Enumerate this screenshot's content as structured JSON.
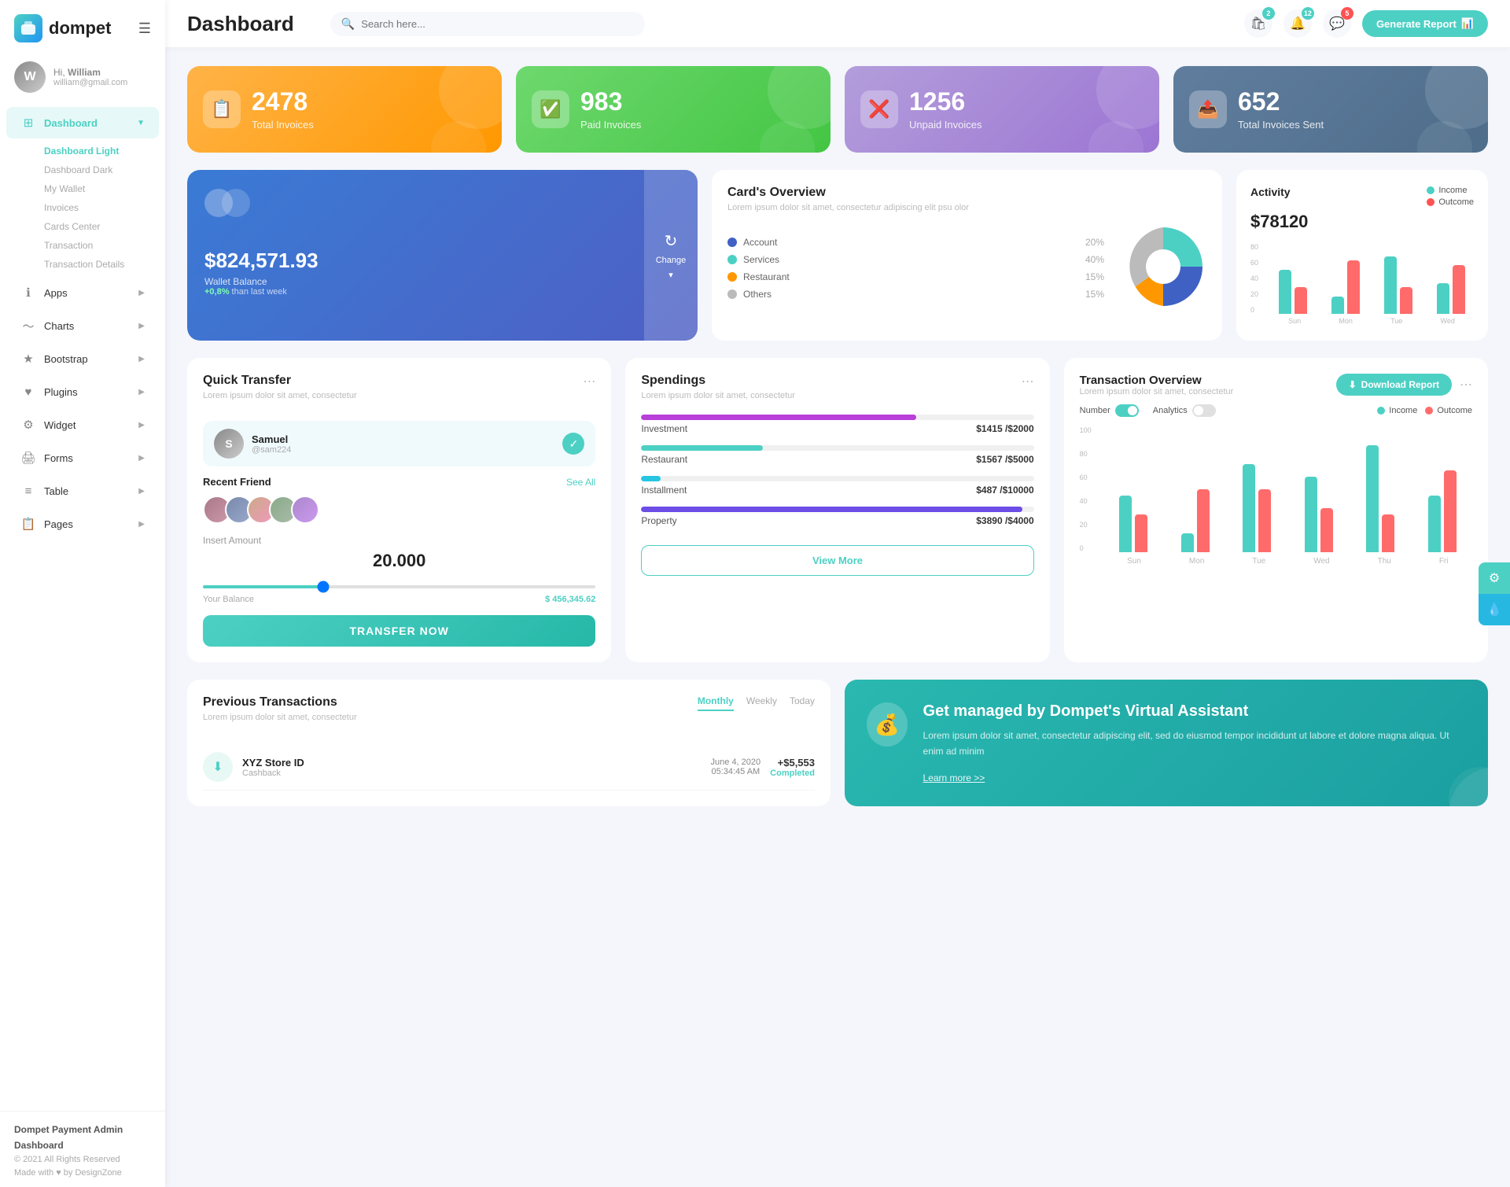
{
  "brand": {
    "logo_text": "dompet",
    "logo_icon": "💳"
  },
  "user": {
    "greeting": "Hi,",
    "name": "William",
    "email": "william@gmail.com",
    "avatar_initial": "W"
  },
  "sidebar": {
    "menu_icon": "☰",
    "nav_items": [
      {
        "id": "dashboard",
        "label": "Dashboard",
        "icon": "⊞",
        "active": true,
        "has_children": true
      },
      {
        "id": "apps",
        "label": "Apps",
        "icon": "ℹ",
        "active": false,
        "has_children": true
      },
      {
        "id": "charts",
        "label": "Charts",
        "icon": "📈",
        "active": false,
        "has_children": true
      },
      {
        "id": "bootstrap",
        "label": "Bootstrap",
        "icon": "★",
        "active": false,
        "has_children": true
      },
      {
        "id": "plugins",
        "label": "Plugins",
        "icon": "♥",
        "active": false,
        "has_children": true
      },
      {
        "id": "widget",
        "label": "Widget",
        "icon": "⚙",
        "active": false,
        "has_children": true
      },
      {
        "id": "forms",
        "label": "Forms",
        "icon": "🖨",
        "active": false,
        "has_children": true
      },
      {
        "id": "table",
        "label": "Table",
        "icon": "≡",
        "active": false,
        "has_children": true
      },
      {
        "id": "pages",
        "label": "Pages",
        "icon": "📋",
        "active": false,
        "has_children": true
      }
    ],
    "sub_items": [
      {
        "label": "Dashboard Light",
        "active": true
      },
      {
        "label": "Dashboard Dark",
        "active": false
      },
      {
        "label": "My Wallet",
        "active": false
      },
      {
        "label": "Invoices",
        "active": false
      },
      {
        "label": "Cards Center",
        "active": false
      },
      {
        "label": "Transaction",
        "active": false
      },
      {
        "label": "Transaction Details",
        "active": false
      }
    ],
    "footer": {
      "title": "Dompet Payment Admin Dashboard",
      "year": "© 2021 All Rights Reserved",
      "made_with": "Made with ♥ by DesignZone"
    }
  },
  "topbar": {
    "title": "Dashboard",
    "search_placeholder": "Search here...",
    "notifications": [
      {
        "icon": "🛍",
        "count": 2,
        "color": "teal"
      },
      {
        "icon": "🔔",
        "count": 12,
        "color": "teal"
      },
      {
        "icon": "💬",
        "count": 5,
        "color": "red"
      }
    ],
    "generate_btn": "Generate Report"
  },
  "stat_cards": [
    {
      "id": "total-invoices",
      "number": "2478",
      "label": "Total Invoices",
      "color": "orange",
      "icon": "📋"
    },
    {
      "id": "paid-invoices",
      "number": "983",
      "label": "Paid Invoices",
      "color": "green",
      "icon": "✅"
    },
    {
      "id": "unpaid-invoices",
      "number": "1256",
      "label": "Unpaid Invoices",
      "color": "purple",
      "icon": "❌"
    },
    {
      "id": "total-sent",
      "number": "652",
      "label": "Total Invoices Sent",
      "color": "blue-gray",
      "icon": "📤"
    }
  ],
  "wallet": {
    "balance": "$824,571.93",
    "label": "Wallet Balance",
    "change_text": "+0,8% than last week",
    "change_btn": "Change"
  },
  "cards_overview": {
    "title": "Card's Overview",
    "subtitle": "Lorem ipsum dolor sit amet, consectetur adipiscing elit psu olor",
    "items": [
      {
        "label": "Account",
        "percent": "20%",
        "color": "#3f61c4"
      },
      {
        "label": "Services",
        "percent": "40%",
        "color": "#4dd0c4"
      },
      {
        "label": "Restaurant",
        "percent": "15%",
        "color": "#ff9800"
      },
      {
        "label": "Others",
        "percent": "15%",
        "color": "#bbb"
      }
    ],
    "pie_data": [
      {
        "label": "Account",
        "value": 20,
        "color": "#3f61c4"
      },
      {
        "label": "Services",
        "value": 40,
        "color": "#4dd0c4"
      },
      {
        "label": "Restaurant",
        "value": 15,
        "color": "#ff9800"
      },
      {
        "label": "Others",
        "value": 25,
        "color": "#bbb"
      }
    ]
  },
  "activity": {
    "title": "Activity",
    "amount": "$78120",
    "legend": [
      {
        "label": "Income",
        "color": "#4dd0c4"
      },
      {
        "label": "Outcome",
        "color": "#ff5252"
      }
    ],
    "chart": {
      "labels": [
        "Sun",
        "Mon",
        "Tue",
        "Wed"
      ],
      "income": [
        50,
        20,
        65,
        35
      ],
      "outcome": [
        30,
        60,
        30,
        55
      ]
    }
  },
  "quick_transfer": {
    "title": "Quick Transfer",
    "subtitle": "Lorem ipsum dolor sit amet, consectetur",
    "person": {
      "name": "Samuel",
      "handle": "@sam224",
      "avatar_initial": "S"
    },
    "recent_label": "Recent Friend",
    "see_more": "See All",
    "amount_label": "Insert Amount",
    "amount_value": "20.000",
    "balance_label": "Your Balance",
    "balance_value": "$ 456,345.62",
    "btn_label": "TRANSFER NOW"
  },
  "spendings": {
    "title": "Spendings",
    "subtitle": "Lorem ipsum dolor sit amet, consectetur",
    "items": [
      {
        "name": "Investment",
        "spent": "$1415",
        "max": "$2000",
        "percent": 70,
        "color": "#b83fd8"
      },
      {
        "name": "Restaurant",
        "spent": "$1567",
        "max": "$5000",
        "percent": 31,
        "color": "#4dd0c4"
      },
      {
        "name": "Installment",
        "spent": "$487",
        "max": "$10000",
        "percent": 5,
        "color": "#26c6e0"
      },
      {
        "name": "Property",
        "spent": "$3890",
        "max": "$4000",
        "percent": 97,
        "color": "#6c4de6"
      }
    ],
    "view_more": "View More"
  },
  "transaction_overview": {
    "title": "Transaction Overview",
    "subtitle": "Lorem ipsum dolor sit amet, consectetur",
    "download_btn": "Download Report",
    "toggle_number": "Number",
    "toggle_analytics": "Analytics",
    "legend": [
      {
        "label": "Income",
        "color": "#4dd0c4"
      },
      {
        "label": "Outcome",
        "color": "#ff6b6b"
      }
    ],
    "chart": {
      "y_labels": [
        "100",
        "80",
        "60",
        "40",
        "20",
        "0"
      ],
      "x_labels": [
        "Sun",
        "Mon",
        "Tue",
        "Wed",
        "Thu",
        "Fri"
      ],
      "income": [
        45,
        25,
        70,
        60,
        85,
        50
      ],
      "outcome": [
        30,
        55,
        50,
        35,
        30,
        65
      ]
    }
  },
  "prev_transactions": {
    "title": "Previous Transactions",
    "subtitle": "Lorem ipsum dolor sit amet, consectetur",
    "tabs": [
      "Monthly",
      "Weekly",
      "Today"
    ],
    "active_tab": "Monthly",
    "items": [
      {
        "icon": "⬇",
        "name": "XYZ Store ID",
        "type": "Cashback",
        "date": "June 4, 2020",
        "time": "05:34:45 AM",
        "amount": "+$5,553",
        "status": "Completed"
      }
    ]
  },
  "virtual_assistant": {
    "title": "Get managed by Dompet's Virtual Assistant",
    "desc": "Lorem ipsum dolor sit amet, consectetur adipiscing elit, sed do eiusmod tempor incididunt ut labore et dolore magna aliqua. Ut enim ad minim",
    "link": "Learn more >>"
  }
}
